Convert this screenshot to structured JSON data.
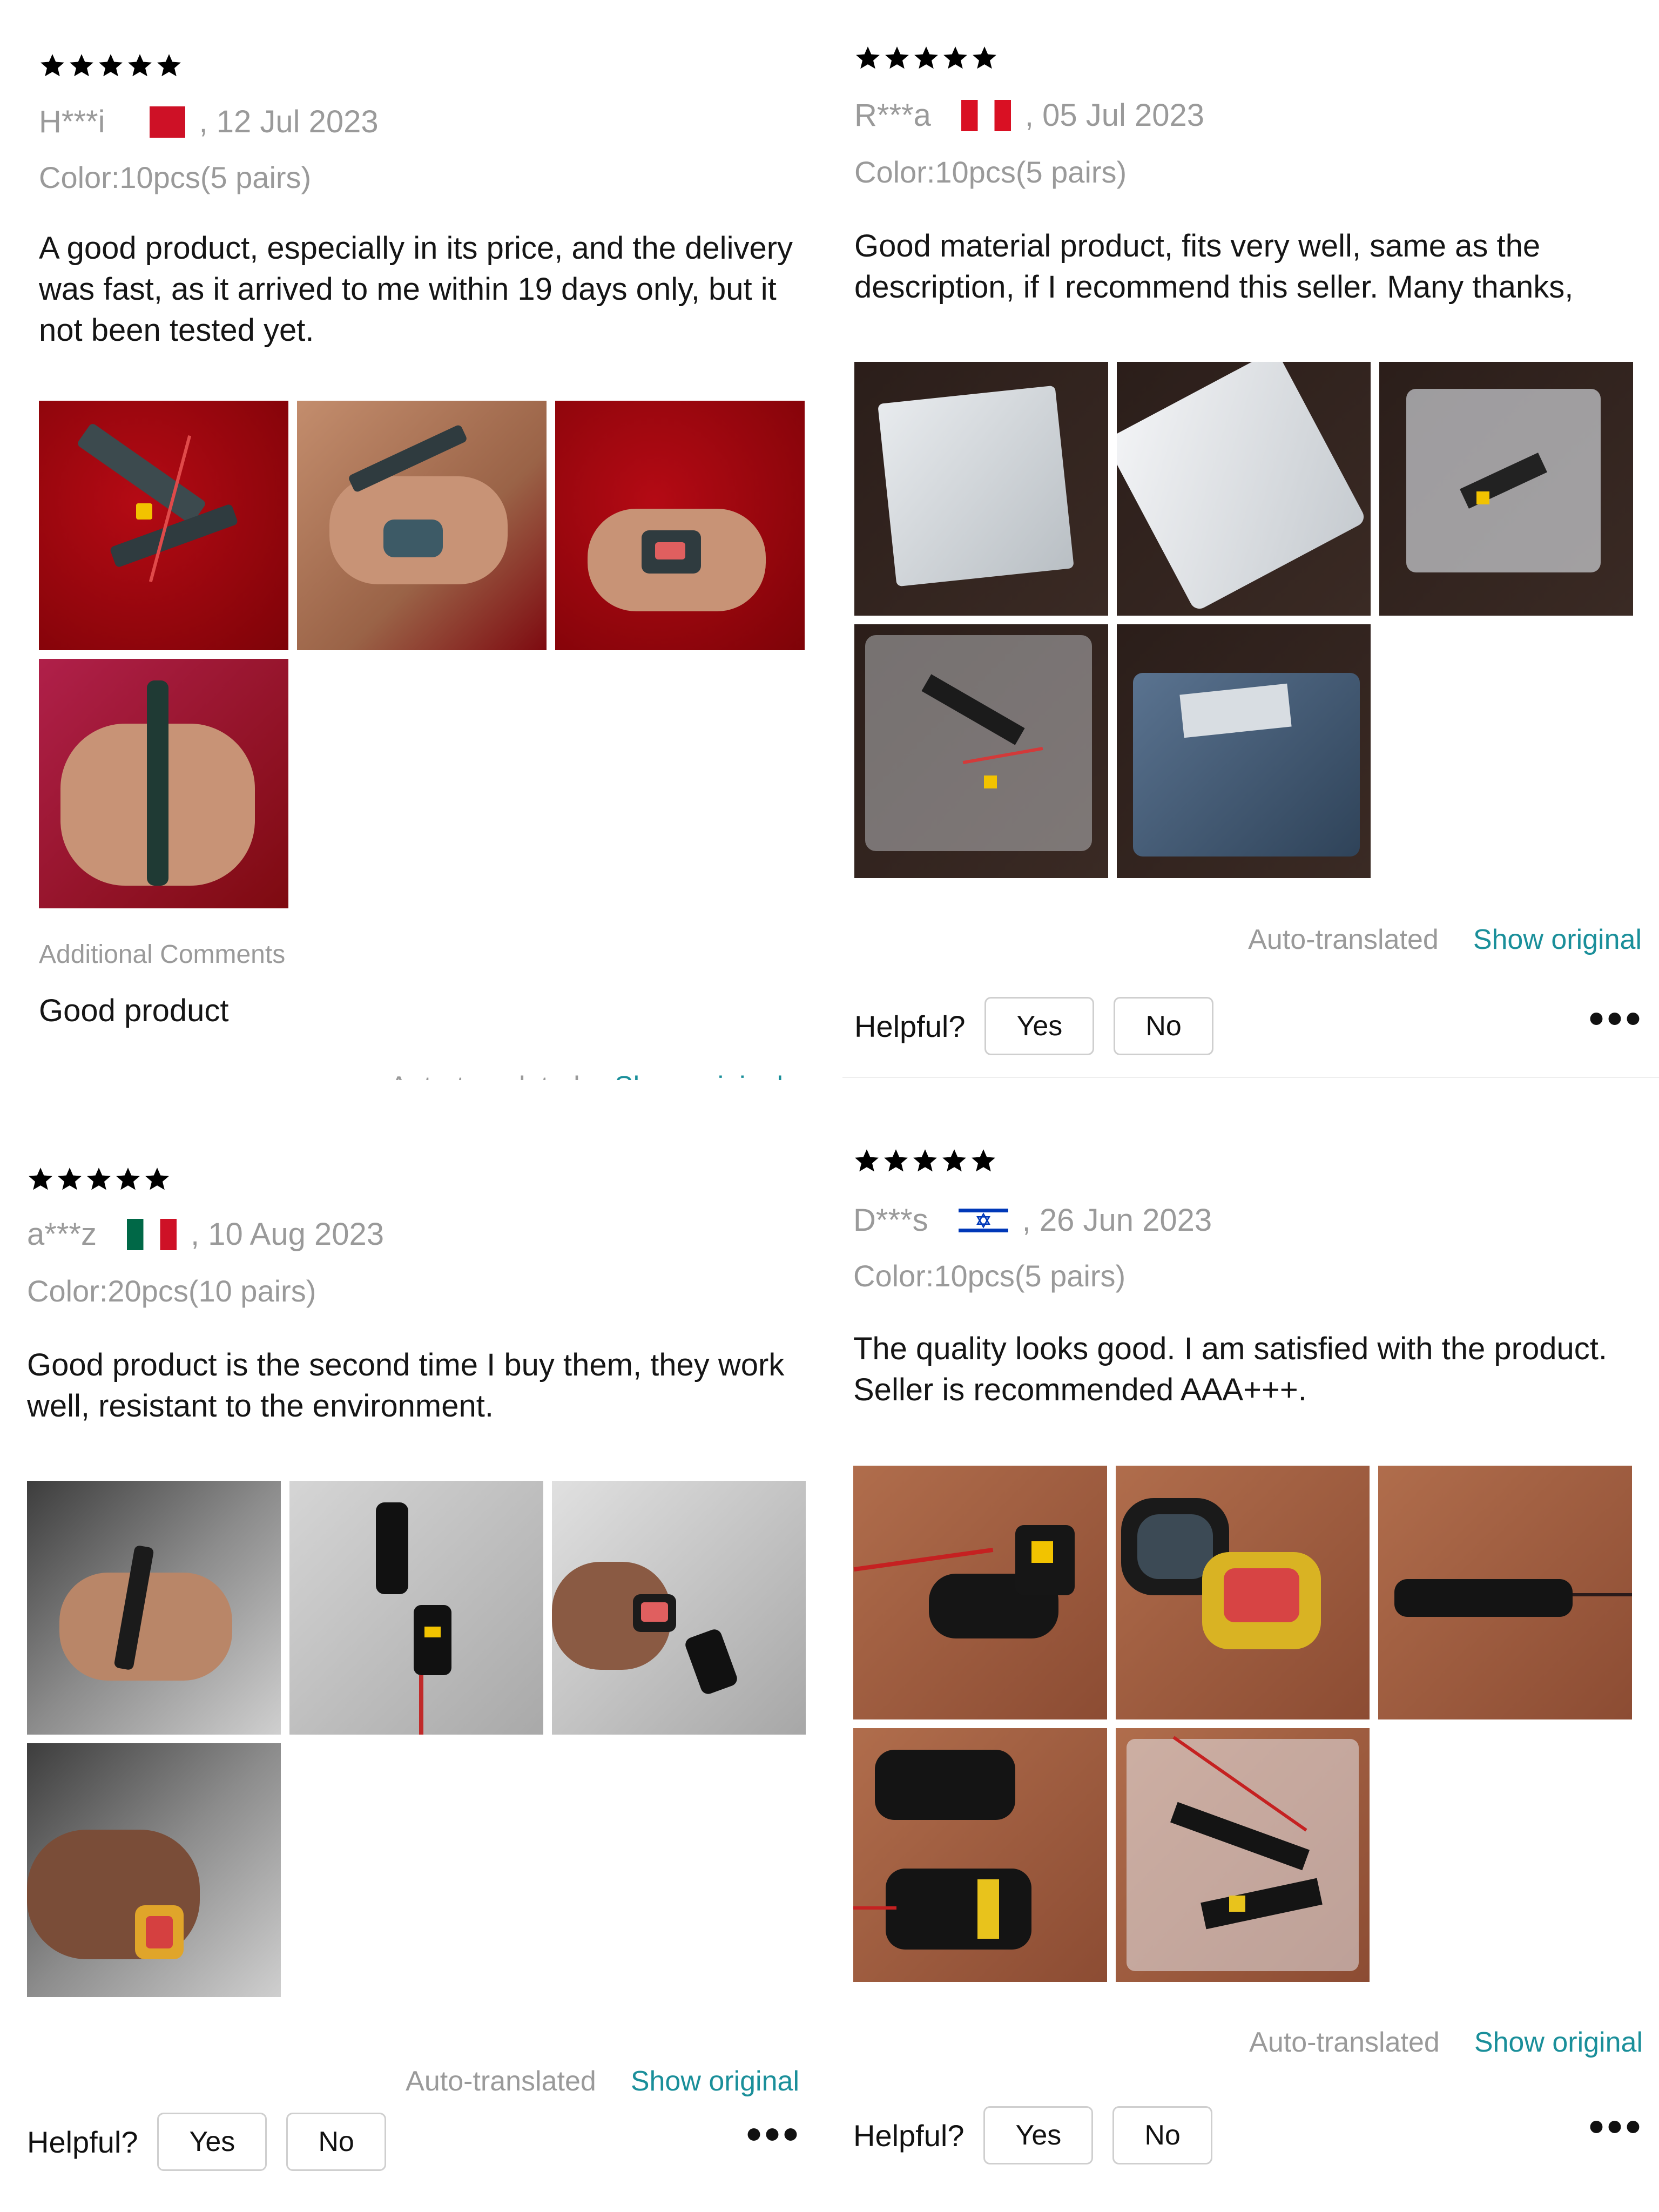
{
  "reviews": [
    {
      "stars": 5,
      "user": "H***i",
      "country_flag": "bahrain-flag-icon",
      "date": ", 12 Jul 2023",
      "color_option": "Color:10pcs(5 pairs)",
      "text": "A good product, especially in its price, and the delivery was fast, as it arrived to me within 19 days only, but it not been tested yet.",
      "photo_count": 4,
      "additional_label": "Additional Comments",
      "additional_text": "Good product",
      "auto_translated": "Auto-translated",
      "show_original": "Show original"
    },
    {
      "stars": 5,
      "user": "R***a",
      "country_flag": "peru-flag-icon",
      "date": ", 05 Jul 2023",
      "color_option": "Color:10pcs(5 pairs)",
      "text": "Good material product, fits very well, same as the description, if I recommend this seller. Many thanks,",
      "photo_count": 5,
      "auto_translated": "Auto-translated",
      "show_original": "Show original",
      "helpful_label": "Helpful?",
      "yes_label": "Yes",
      "no_label": "No",
      "more_label": "•••"
    },
    {
      "stars": 5,
      "user": "a***z",
      "country_flag": "mexico-flag-icon",
      "date": ", 10 Aug 2023",
      "color_option": "Color:20pcs(10 pairs)",
      "text": "Good product is the second time I buy them, they work well, resistant to the environment.",
      "photo_count": 4,
      "auto_translated": "Auto-translated",
      "show_original": "Show original",
      "helpful_label": "Helpful?",
      "yes_label": "Yes",
      "no_label": "No",
      "more_label": "•••"
    },
    {
      "stars": 5,
      "user": "D***s",
      "country_flag": "israel-flag-icon",
      "date": ", 26 Jun 2023",
      "color_option": "Color:10pcs(5 pairs)",
      "text": "The quality looks good.  I am satisfied with the product.   Seller is recommended AAA+++.",
      "photo_count": 5,
      "auto_translated": "Auto-translated",
      "show_original": "Show original",
      "helpful_label": "Helpful?",
      "yes_label": "Yes",
      "no_label": "No",
      "more_label": "•••"
    }
  ]
}
